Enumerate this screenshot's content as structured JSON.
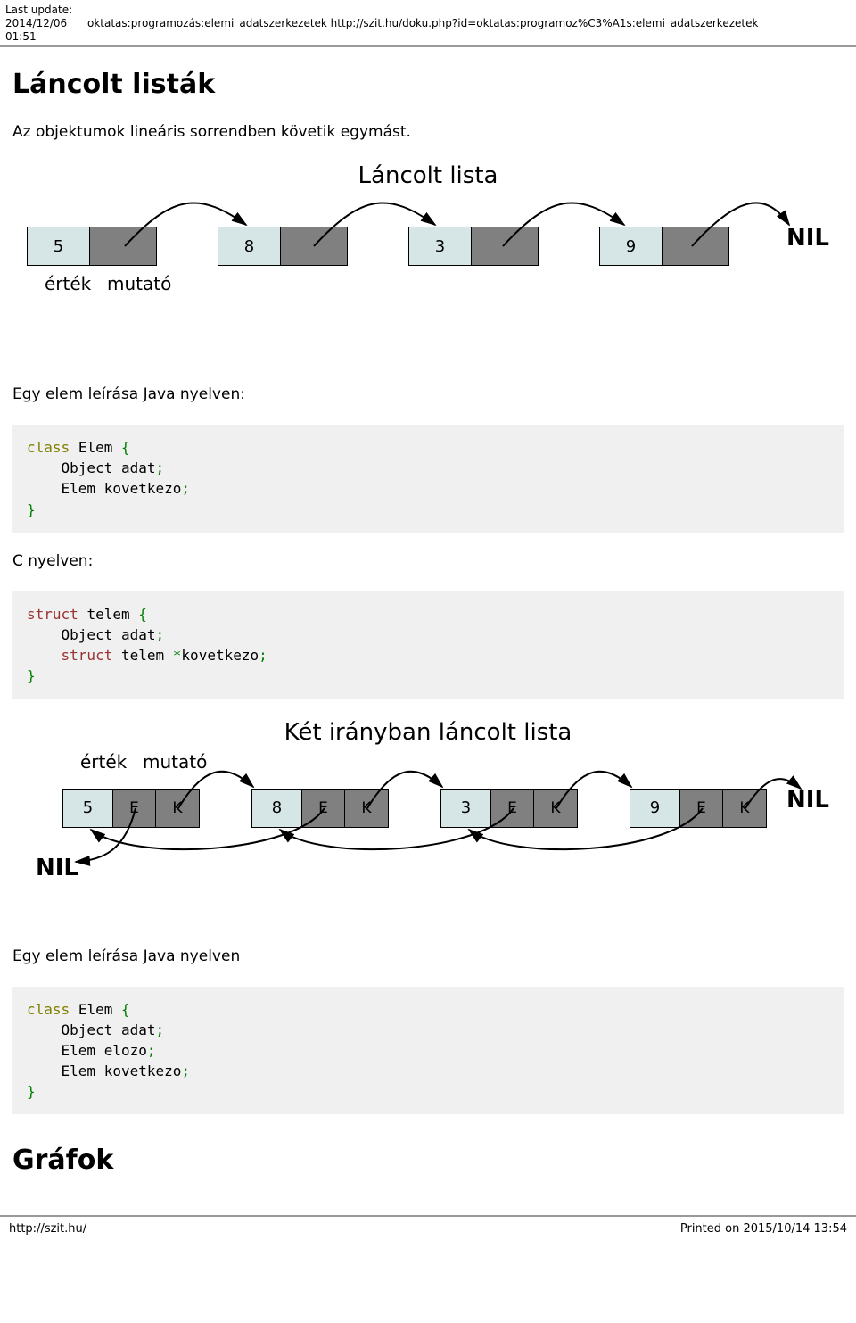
{
  "header": {
    "last_update_label": "Last update:",
    "timestamp": "2014/12/06 01:51",
    "breadcrumb": "oktatas:programozás:elemi_adatszerkezetek http://szit.hu/doku.php?id=oktatas:programoz%C3%A1s:elemi_adatszerkezetek"
  },
  "h1_lancolt": "Láncolt listák",
  "p_intro": "Az objektumok lineáris sorrendben követik egymást.",
  "diagram1": {
    "title": "Láncolt lista",
    "values": [
      "5",
      "8",
      "3",
      "9"
    ],
    "nil": "NIL",
    "label_ertek": "érték",
    "label_mutato": "mutató"
  },
  "p_java1": "Egy elem leírása Java nyelven:",
  "code_java1": {
    "kw_class": "class",
    "class_name": "Elem",
    "brace_open": "{",
    "obj": "Object",
    "adat": "adat",
    "semi": ";",
    "elem": "Elem",
    "kov": "kovetkezo",
    "brace_close": "}"
  },
  "p_c": "C nyelven:",
  "code_c": {
    "kw_struct": "struct",
    "telem": "telem",
    "brace_open": "{",
    "obj": "Object",
    "adat": "adat",
    "semi": ";",
    "kw_struct2": "struct",
    "telem2": "telem",
    "star": "*",
    "kov": "kovetkezo",
    "brace_close": "}"
  },
  "diagram2": {
    "title": "Két irányban láncolt lista",
    "label_ertek": "érték",
    "label_mutato": "mutató",
    "nodes": [
      {
        "val": "5",
        "e": "E",
        "k": "K"
      },
      {
        "val": "8",
        "e": "E",
        "k": "K"
      },
      {
        "val": "3",
        "e": "E",
        "k": "K"
      },
      {
        "val": "9",
        "e": "E",
        "k": "K"
      }
    ],
    "nil": "NIL"
  },
  "p_java2": "Egy elem leírása Java nyelven",
  "code_java2": {
    "kw_class": "class",
    "class_name": "Elem",
    "brace_open": "{",
    "obj": "Object",
    "adat": "adat",
    "semi": ";",
    "elem1": "Elem",
    "elozo": "elozo",
    "elem2": "Elem",
    "kov": "kovetkezo",
    "brace_close": "}"
  },
  "h1_grafok": "Gráfok",
  "footer": {
    "left": "http://szit.hu/",
    "right": "Printed on 2015/10/14 13:54"
  }
}
